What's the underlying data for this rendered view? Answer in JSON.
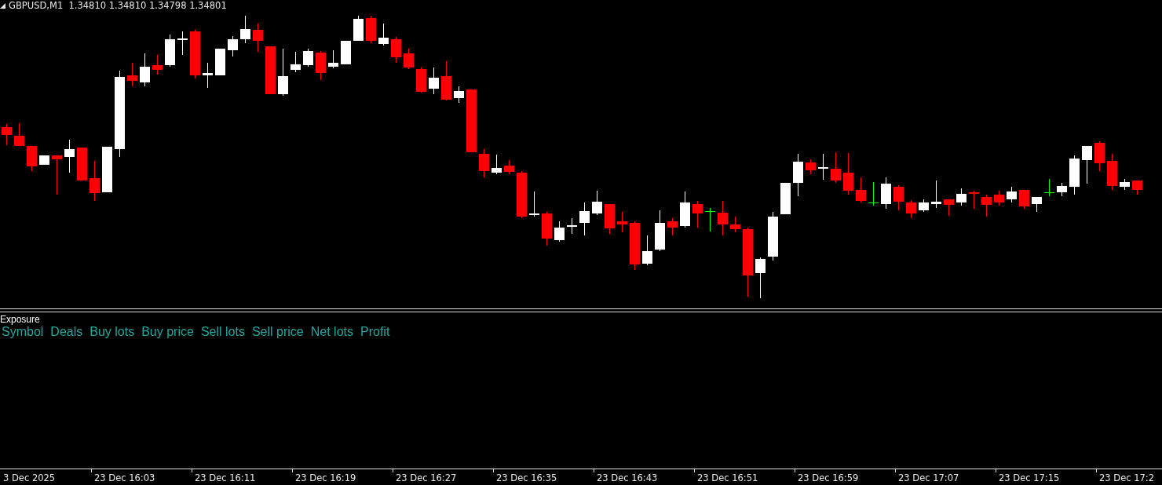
{
  "chart": {
    "symbol_line": "GBPUSD,M1  1.34810 1.34810 1.34798 1.34801"
  },
  "indicator": {
    "title": "Exposure",
    "columns": [
      "Symbol",
      "Deals",
      "Buy lots",
      "Buy price",
      "Sell lots",
      "Sell price",
      "Net lots",
      "Profit"
    ]
  },
  "time_axis": [
    "3 Dec 2025",
    "23 Dec 16:03",
    "23 Dec 16:11",
    "23 Dec 16:19",
    "23 Dec 16:27",
    "23 Dec 16:35",
    "23 Dec 16:43",
    "23 Dec 16:51",
    "23 Dec 16:59",
    "23 Dec 17:07",
    "23 Dec 17:15",
    "23 Dec 17:2"
  ]
}
